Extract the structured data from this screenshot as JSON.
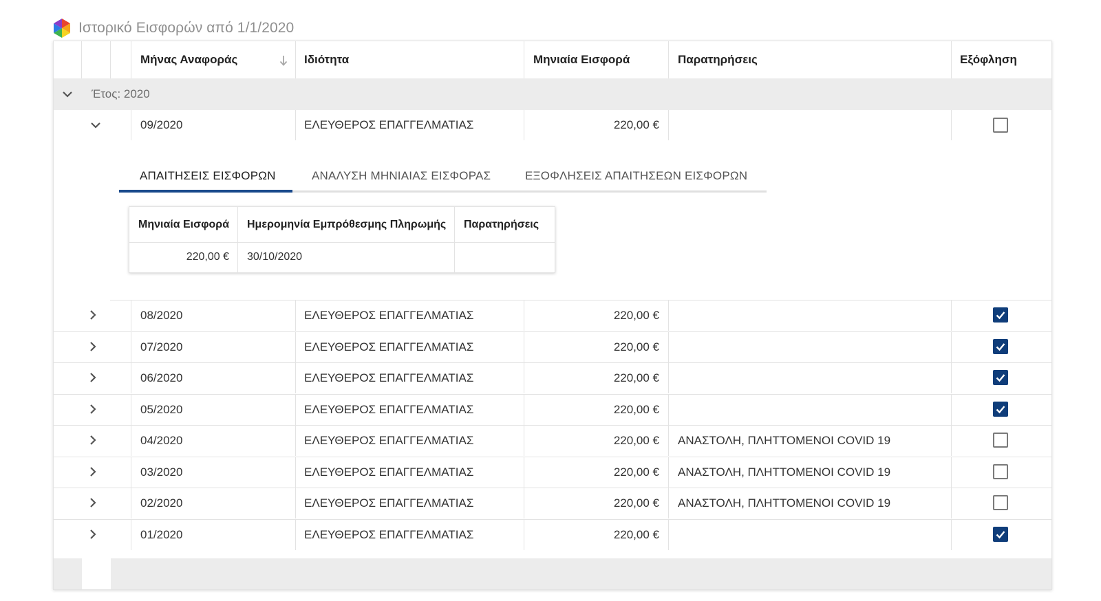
{
  "page": {
    "title": "Ιστορικό Εισφορών από 1/1/2020"
  },
  "grid": {
    "columns": {
      "month": "Μήνας Αναφοράς",
      "capacity": "Ιδιότητα",
      "amount": "Μηνιαία Εισφορά",
      "notes": "Παρατηρήσεις",
      "paid": "Εξόφληση"
    },
    "group": {
      "label": "Έτος: 2020"
    },
    "expanded_row": {
      "month": "09/2020",
      "capacity": "ΕΛΕΥΘΕΡΟΣ ΕΠΑΓΓΕΛΜΑΤΙΑΣ",
      "amount": "220,00 €",
      "notes": "",
      "paid": false
    },
    "detail": {
      "tabs": [
        "ΑΠΑΙΤΗΣΕΙΣ ΕΙΣΦΟΡΩΝ",
        "ΑΝΑΛΥΣΗ ΜΗΝΙΑΙΑΣ ΕΙΣΦΟΡΑΣ",
        "ΕΞΟΦΛΗΣΕΙΣ ΑΠΑΙΤΗΣΕΩΝ ΕΙΣΦΟΡΩΝ"
      ],
      "active_tab": "ΑΠΑΙΤΗΣΕΙΣ ΕΙΣΦΟΡΩΝ",
      "columns": {
        "amount": "Μηνιαία Εισφορά",
        "due_date": "Ημερομηνία Εμπρόθεσμης Πληρωμής",
        "notes": "Παρατηρήσεις"
      },
      "row": {
        "amount": "220,00 €",
        "due_date": "30/10/2020",
        "notes": ""
      }
    },
    "rows": [
      {
        "month": "08/2020",
        "capacity": "ΕΛΕΥΘΕΡΟΣ ΕΠΑΓΓΕΛΜΑΤΙΑΣ",
        "amount": "220,00 €",
        "notes": "",
        "paid": true
      },
      {
        "month": "07/2020",
        "capacity": "ΕΛΕΥΘΕΡΟΣ ΕΠΑΓΓΕΛΜΑΤΙΑΣ",
        "amount": "220,00 €",
        "notes": "",
        "paid": true
      },
      {
        "month": "06/2020",
        "capacity": "ΕΛΕΥΘΕΡΟΣ ΕΠΑΓΓΕΛΜΑΤΙΑΣ",
        "amount": "220,00 €",
        "notes": "",
        "paid": true
      },
      {
        "month": "05/2020",
        "capacity": "ΕΛΕΥΘΕΡΟΣ ΕΠΑΓΓΕΛΜΑΤΙΑΣ",
        "amount": "220,00 €",
        "notes": "",
        "paid": true
      },
      {
        "month": "04/2020",
        "capacity": "ΕΛΕΥΘΕΡΟΣ ΕΠΑΓΓΕΛΜΑΤΙΑΣ",
        "amount": "220,00 €",
        "notes": "ΑΝΑΣΤΟΛΗ, ΠΛΗΤΤΟΜΕΝΟΙ COVID 19",
        "paid": false
      },
      {
        "month": "03/2020",
        "capacity": "ΕΛΕΥΘΕΡΟΣ ΕΠΑΓΓΕΛΜΑΤΙΑΣ",
        "amount": "220,00 €",
        "notes": "ΑΝΑΣΤΟΛΗ, ΠΛΗΤΤΟΜΕΝΟΙ COVID 19",
        "paid": false
      },
      {
        "month": "02/2020",
        "capacity": "ΕΛΕΥΘΕΡΟΣ ΕΠΑΓΓΕΛΜΑΤΙΑΣ",
        "amount": "220,00 €",
        "notes": "ΑΝΑΣΤΟΛΗ, ΠΛΗΤΤΟΜΕΝΟΙ COVID 19",
        "paid": false
      },
      {
        "month": "01/2020",
        "capacity": "ΕΛΕΥΘΕΡΟΣ ΕΠΑΓΓΕΛΜΑΤΙΑΣ",
        "amount": "220,00 €",
        "notes": "",
        "paid": true
      }
    ]
  },
  "colors": {
    "accent": "#1a4a8c",
    "checkbox_checked": "#0f3d7a",
    "group_bg": "#ececec"
  },
  "icons": {
    "logo": "hexagon-logo-icon",
    "sort": "arrow-down-icon",
    "collapse": "chevron-down-icon",
    "expand": "chevron-right-icon",
    "check": "checkmark-icon"
  }
}
